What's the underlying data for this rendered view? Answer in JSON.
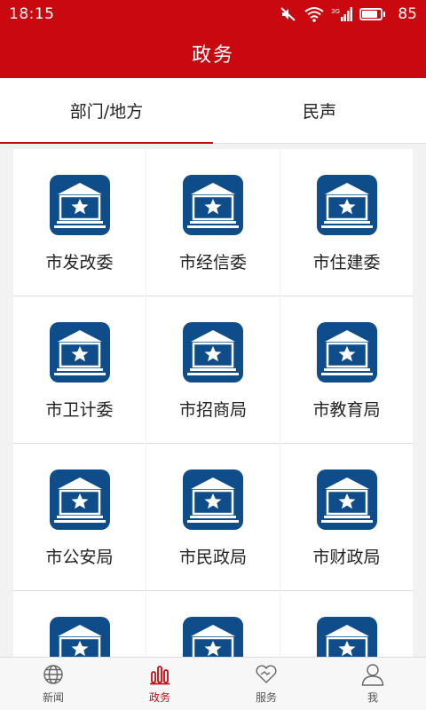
{
  "status_bar": {
    "time": "18:15",
    "battery_percent": "85",
    "battery_level": 0.85
  },
  "header": {
    "title": "政务"
  },
  "tabs": [
    {
      "label": "部门/地方",
      "active": true
    },
    {
      "label": "民声",
      "active": false
    }
  ],
  "departments": [
    {
      "label": "市发改委",
      "icon": "government-building-icon"
    },
    {
      "label": "市经信委",
      "icon": "government-building-icon"
    },
    {
      "label": "市住建委",
      "icon": "government-building-icon"
    },
    {
      "label": "市卫计委",
      "icon": "government-building-icon"
    },
    {
      "label": "市招商局",
      "icon": "government-building-icon"
    },
    {
      "label": "市教育局",
      "icon": "government-building-icon"
    },
    {
      "label": "市公安局",
      "icon": "government-building-icon"
    },
    {
      "label": "市民政局",
      "icon": "government-building-icon"
    },
    {
      "label": "市财政局",
      "icon": "government-building-icon"
    },
    {
      "label": "",
      "icon": "government-building-icon"
    },
    {
      "label": "",
      "icon": "government-building-icon"
    },
    {
      "label": "",
      "icon": "government-building-icon"
    }
  ],
  "bottom_nav": [
    {
      "label": "新闻",
      "icon": "globe-icon",
      "active": false
    },
    {
      "label": "政务",
      "icon": "bar-chart-icon",
      "active": true
    },
    {
      "label": "服务",
      "icon": "handshake-heart-icon",
      "active": false
    },
    {
      "label": "我",
      "icon": "user-icon",
      "active": false
    }
  ],
  "colors": {
    "primary": "#c9080f",
    "icon_bg": "#0e4d8a",
    "background": "#f2f2f2"
  }
}
